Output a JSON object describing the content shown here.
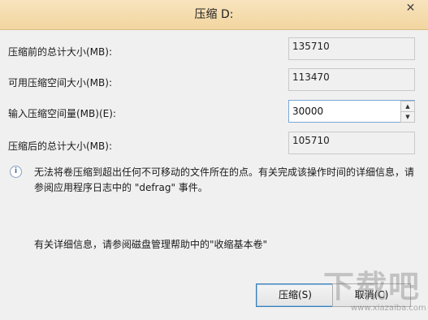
{
  "window": {
    "title": "压缩 D:",
    "close_glyph": "✕"
  },
  "fields": {
    "total_before": {
      "label": "压缩前的总计大小(MB):",
      "value": "135710"
    },
    "available": {
      "label": "可用压缩空间大小(MB):",
      "value": "113470"
    },
    "shrink_amount": {
      "label": "输入压缩空间量(MB)(E):",
      "value": "30000"
    },
    "total_after": {
      "label": "压缩后的总计大小(MB):",
      "value": "105710"
    }
  },
  "info": {
    "icon": "info-icon",
    "icon_glyph": "i",
    "text": "无法将卷压缩到超出任何不可移动的文件所在的点。有关完成该操作时间的详细信息，请参阅应用程序日志中的 \"defrag\" 事件。"
  },
  "help_text": "有关详细信息，请参阅磁盘管理帮助中的\"收缩基本卷\"",
  "buttons": {
    "ok": "压缩(S)",
    "cancel": "取消(C)"
  },
  "spinner": {
    "up_glyph": "▲",
    "down_glyph": "▼"
  },
  "watermark": {
    "big": "下载吧",
    "small": "www.xiazaiba.com"
  }
}
